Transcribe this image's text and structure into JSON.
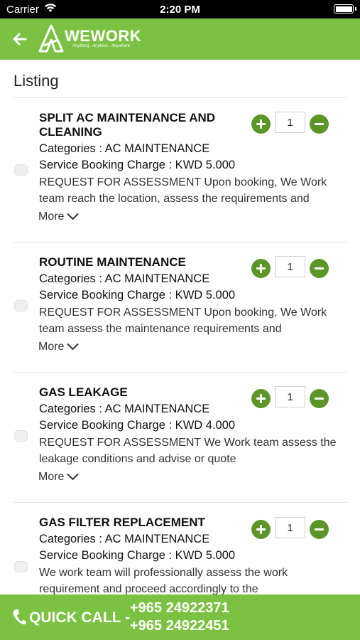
{
  "status_bar": {
    "carrier": "Carrier",
    "time": "2:20 PM"
  },
  "header": {
    "brand": "WEWORK",
    "tagline": "Anything . Anytime . Anywhere",
    "colors": {
      "primary": "#7cc242",
      "button": "#5d9628"
    }
  },
  "page_title": "Listing",
  "items": [
    {
      "name": "SPLIT AC MAINTENANCE AND CLEANING",
      "categories": "Categories :  AC MAINTENANCE",
      "charge": "Service Booking Charge :  KWD 5.000",
      "description": "REQUEST FOR ASSESSMENT Upon booking, We Work team reach the location, assess the requirements and",
      "more_label": "More",
      "quantity": "1",
      "checked": false
    },
    {
      "name": "ROUTINE MAINTENANCE",
      "categories": "Categories :  AC MAINTENANCE",
      "charge": "Service Booking Charge :  KWD 5.000",
      "description": "REQUEST FOR ASSESSMENT Upon booking, We Work team assess the maintenance requirements and",
      "more_label": "More",
      "quantity": "1",
      "checked": false
    },
    {
      "name": "GAS LEAKAGE",
      "categories": "Categories :  AC MAINTENANCE",
      "charge": "Service Booking Charge :  KWD 4.000",
      "description": "REQUEST FOR ASSESSMENT We Work team assess the leakage conditions and advise or quote",
      "more_label": "More",
      "quantity": "1",
      "checked": false
    },
    {
      "name": "GAS FILTER REPLACEMENT",
      "categories": "Categories :  AC MAINTENANCE",
      "charge": "Service Booking Charge :  KWD 5.000",
      "description": "We work team will professionally assess the work requirement and proceed accordingly to the",
      "quantity": "1",
      "checked": false
    }
  ],
  "quick_call": {
    "label": "QUICK CALL -",
    "numbers": [
      "+965 24922371",
      "+965 24922451"
    ]
  }
}
